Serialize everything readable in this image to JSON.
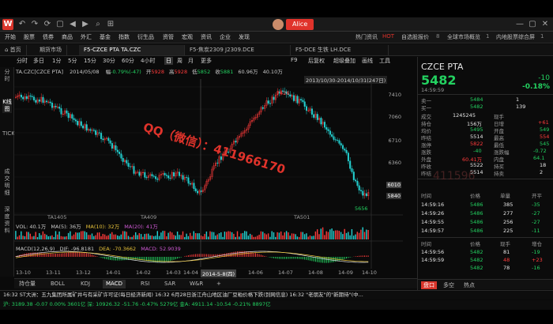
{
  "titlebar": {
    "user": "Alice"
  },
  "menu": [
    "开始",
    "股票",
    "债券",
    "商品",
    "外汇",
    "基金",
    "指数",
    "衍生品",
    "资管",
    "宏观",
    "资讯",
    "企业",
    "发现"
  ],
  "menu_right": [
    "热门资讯",
    "HOT",
    "自选股报价",
    "8",
    "全球市场概览",
    "1",
    "内地股票综合屏",
    "1"
  ],
  "tabs": [
    "首页",
    "期货市场",
    "F5-CZCE PTA TA.CZC",
    "F5-焦炭2309 J2309.DCE",
    "F5-DCE 生铁 LH.DCE"
  ],
  "periods": [
    "分时",
    "多日",
    "1分",
    "5分",
    "15分",
    "30分",
    "60分",
    "4小时",
    "日",
    "周",
    "月",
    "更多"
  ],
  "toolbar_right": [
    "F9",
    "后复权",
    "超级叠加",
    "画线",
    "工具"
  ],
  "leftnav": [
    "分时",
    "K线图",
    "TICK",
    "成交明细",
    "深度资料"
  ],
  "info": {
    "code": "TA.CZC[CZCE PTA]",
    "date": "2014/05/08",
    "open_label": "开",
    "open": "5928",
    "high_label": "高",
    "high": "5928",
    "low_label": "低",
    "low": "5852",
    "close_label": "收",
    "close": "5881",
    "volume": "40.10万",
    "change_label": "幅",
    "change": "-0.79%(-47)",
    "amount": "60.96万"
  },
  "range_label": "2013/10/30-2014/10/31(247日)",
  "y_labels": [
    "7410",
    "7060",
    "6710",
    "6360",
    "6010",
    "5840"
  ],
  "high_marker": "7426",
  "low_marker": "5656",
  "contract_labels": [
    "TA1405",
    "TA409",
    "TA501"
  ],
  "vol_line": {
    "label": "VOL: 40.1万",
    "ma5": "MA(5): 36万",
    "ma10": "MA(10): 32万",
    "ma20": "MA(20): 41万"
  },
  "macd_line": {
    "label": "MACD(12,26,9)",
    "dif": "DIF: -96.8181",
    "dea": "DEA: -70.3662",
    "macd": "MACD: 52.9039"
  },
  "x_labels": [
    "13-10",
    "13-11",
    "13-12",
    "14-01",
    "14-02",
    "14-03",
    "14-04",
    "2014-5-8(四)",
    "14-06",
    "14-07",
    "14-08",
    "14-09",
    "14-10"
  ],
  "indicators": [
    "持仓量",
    "BOLL",
    "KDJ",
    "MACD",
    "RSI",
    "SAR",
    "W&R",
    "+"
  ],
  "right": {
    "name": "CZCE PTA",
    "price": "5482",
    "change": "-10",
    "pct": "-0.18%",
    "time": "14:59:59",
    "rows": [
      {
        "l": "卖一",
        "v": "5484",
        "v2": "1"
      },
      {
        "l": "买一",
        "v": "5482",
        "v2": "139"
      },
      {
        "l": "成交",
        "v": "1245245",
        "l2": "现手",
        "v2": ""
      },
      {
        "l": "持仓",
        "v": "156万",
        "l2": "日增",
        "v2": "+61"
      },
      {
        "l": "均价",
        "v": "5495",
        "l2": "开盘",
        "v2": "549"
      },
      {
        "l": "昨结",
        "v": "5514",
        "l2": "最高",
        "v2": "554"
      },
      {
        "l": "涨停",
        "v": "5822",
        "l2": "最低",
        "v2": "545"
      },
      {
        "l": "涨跌",
        "v": "-40",
        "l2": "涨跌幅",
        "v2": "-0.72"
      },
      {
        "l": "外盘",
        "v": "60.41万",
        "l2": "内盘",
        "v2": "64.1"
      },
      {
        "l": "昨收",
        "v": "5522",
        "l2": "持买",
        "v2": "18"
      },
      {
        "l": "昨结",
        "v": "5514",
        "l2": "持卖",
        "v2": "2"
      }
    ],
    "trade_header": [
      "时间",
      "价格",
      "单量",
      "开平"
    ],
    "trades1": [
      {
        "t": "14:59:16",
        "p": "5486",
        "q": "385",
        "o": "-35"
      },
      {
        "t": "14:59:26",
        "p": "5486",
        "q": "277",
        "o": "-27"
      },
      {
        "t": "14:59:55",
        "p": "5486",
        "q": "256",
        "o": "-27"
      },
      {
        "t": "14:59:57",
        "p": "5486",
        "q": "225",
        "o": "-11"
      }
    ],
    "trade_header2": [
      "时间",
      "价格",
      "现手",
      "增仓"
    ],
    "trades2": [
      {
        "t": "14:59:56",
        "p": "5482",
        "q": "81",
        "o": "-19"
      },
      {
        "t": "14:59:59",
        "p": "5482",
        "q": "48",
        "o": "+23"
      },
      {
        "t": "",
        "p": "5482",
        "q": "78",
        "o": "-16"
      }
    ],
    "bottom_tabs": [
      "盘口",
      "多空",
      "热点"
    ]
  },
  "status1": "16:32 ST大洲：五九集团所属矿井与有采矿许可证(每日经济新闻)   16:32 6月28日浙江舟山地区油厂豆粕价格下跌(到网信息)   16:32 \"老朋友\"的\"新期待\"(中...",
  "status2": "沪: 3189.38  -0.07  0.00%  3601亿   深: 10926.32  -51.76  -0.47%  5279亿   金A: 4911.14  -10.54  -0.21%  8897亿",
  "watermark": "QQ（微信）：411966170",
  "right_watermark": "411596"
}
